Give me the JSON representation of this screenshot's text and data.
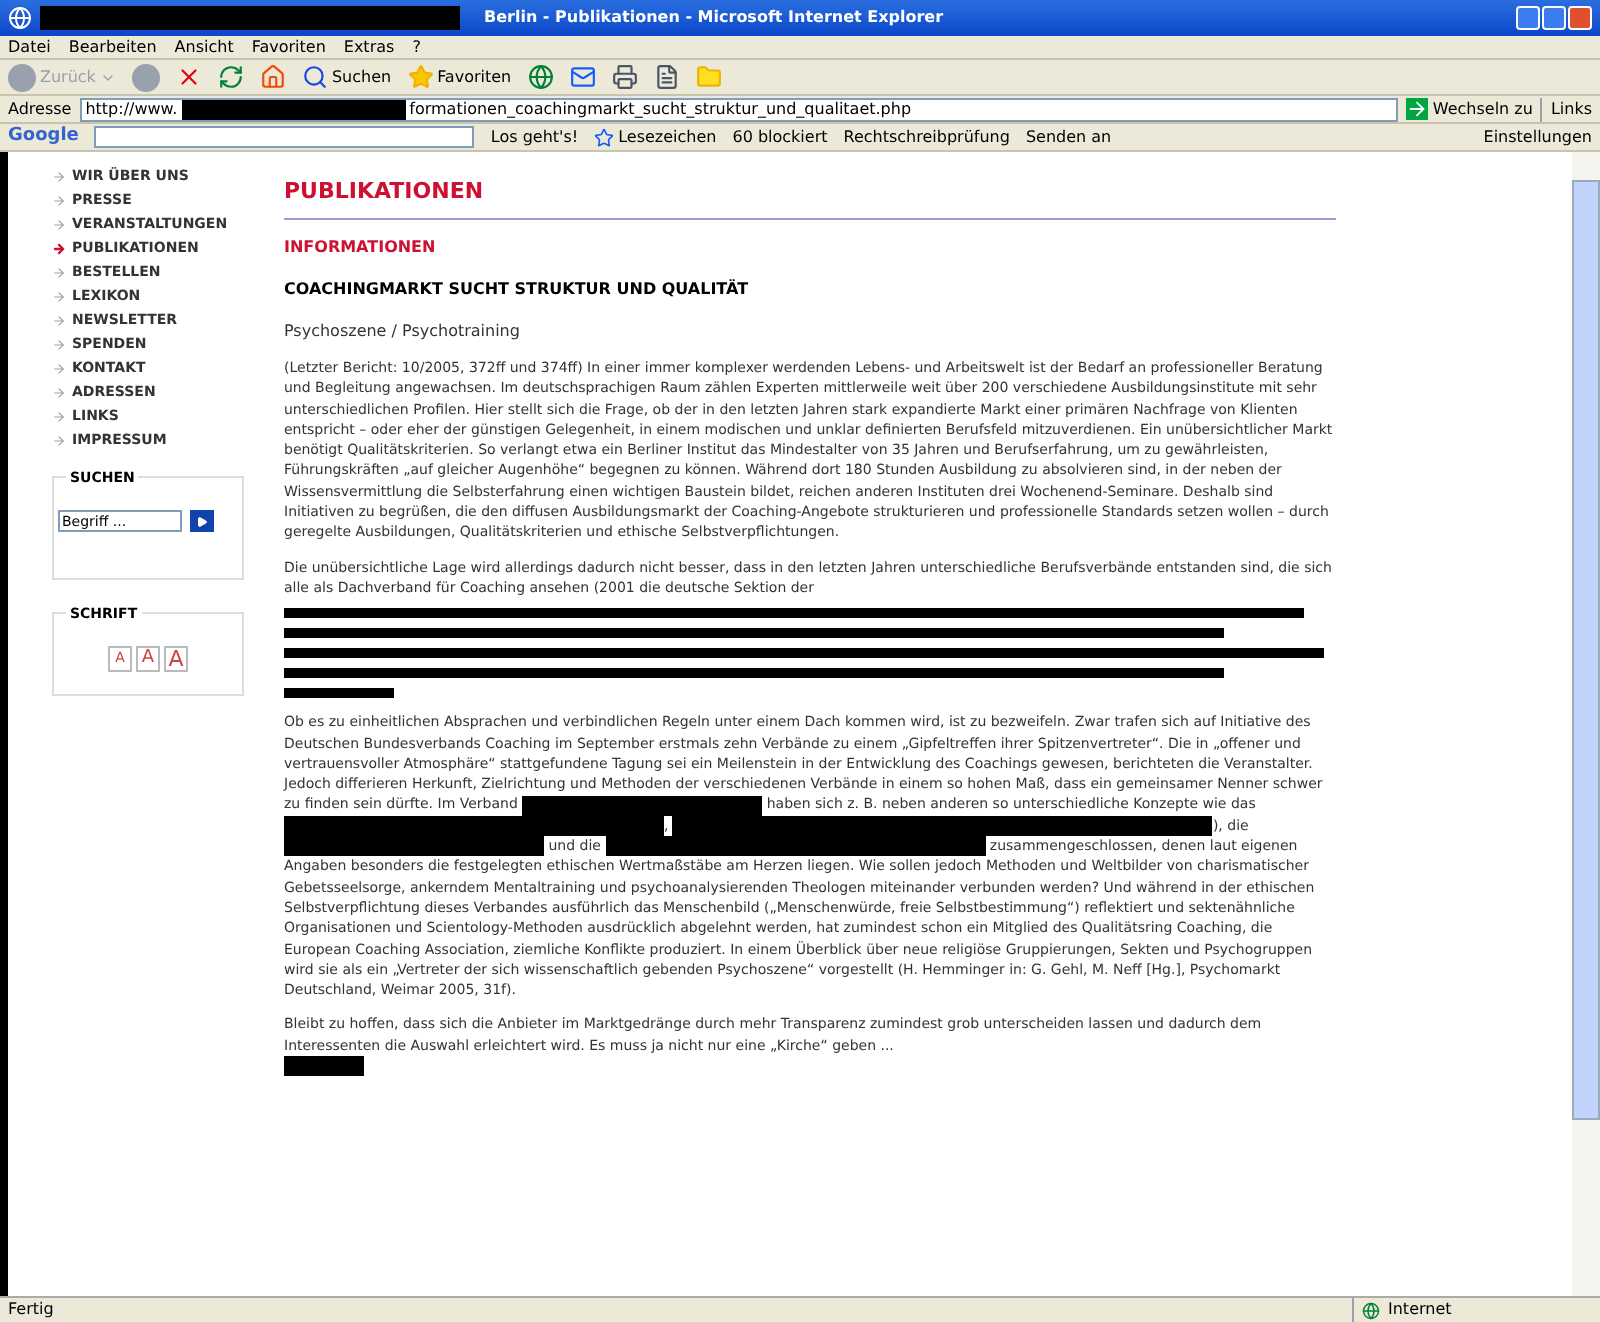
{
  "window": {
    "title": "Berlin - Publikationen - Microsoft Internet Explorer"
  },
  "menu": [
    "Datei",
    "Bearbeiten",
    "Ansicht",
    "Favoriten",
    "Extras",
    "?"
  ],
  "toolbar": {
    "back": "Zurück",
    "search": "Suchen",
    "favorites": "Favoriten"
  },
  "address_bar": {
    "label": "Adresse",
    "url_start": "http://www.",
    "url_end": "formationen_coachingmarkt_sucht_struktur_und_qualitaet.php",
    "go": "Wechseln zu",
    "links": "Links"
  },
  "google_bar": {
    "logo": "Google",
    "go": "Los geht's!",
    "bookmarks": "Lesezeichen",
    "blocked": "60 blockiert",
    "spell": "Rechtschreibprüfung",
    "send": "Senden an",
    "settings": "Einstellungen"
  },
  "sidebar": {
    "items": [
      {
        "label": "WIR ÜBER UNS",
        "selected": false
      },
      {
        "label": "PRESSE",
        "selected": false
      },
      {
        "label": "VERANSTALTUNGEN",
        "selected": false
      },
      {
        "label": "PUBLIKATIONEN",
        "selected": true
      },
      {
        "label": "BESTELLEN",
        "selected": false
      },
      {
        "label": "LEXIKON",
        "selected": false
      },
      {
        "label": "NEWSLETTER",
        "selected": false
      },
      {
        "label": "SPENDEN",
        "selected": false
      },
      {
        "label": "KONTAKT",
        "selected": false
      },
      {
        "label": "ADRESSEN",
        "selected": false
      },
      {
        "label": "LINKS",
        "selected": false
      },
      {
        "label": "IMPRESSUM",
        "selected": false
      }
    ],
    "search": {
      "title": "SUCHEN",
      "placeholder": "Begriff ..."
    },
    "font_size": {
      "title": "SCHRIFT",
      "buttons": [
        "A",
        "A",
        "A"
      ]
    }
  },
  "content": {
    "heading": "PUBLIKATIONEN",
    "section": "INFORMATIONEN",
    "title": "COACHINGMARKT SUCHT STRUKTUR UND QUALITÄT",
    "category": "Psychoszene / Psychotraining",
    "paragraphs": [
      [
        {
          "kind": "text",
          "text": "(Letzter Bericht: 10/2005, 372ff und 374ff) In einer immer komplexer werdenden Lebens- und Arbeitswelt ist der Bedarf an professioneller Beratung und Begleitung angewachsen. Im deutschsprachigen Raum zählen Experten mittlerweile weit über 200 verschiedene Ausbildungsinstitute mit sehr unterschiedlichen Profilen. Hier stellt sich die Frage, ob der in den letzten Jahren stark expandierte Markt einer primären Nachfrage von Klienten entspricht – oder eher der günstigen Gelegenheit, in einem modischen und unklar definierten Berufsfeld mitzuverdienen. Ein unübersichtlicher Markt benötigt Qualitätskriterien. So verlangt etwa ein Berliner Institut das Mindestalter von 35 Jahren und Berufserfahrung, um zu gewährleisten, Führungskräften „auf gleicher Augenhöhe“ begegnen zu können. Während dort 180 Stunden Ausbildung zu absolvieren sind, in der neben der Wissensvermittlung die Selbsterfahrung einen wichtigen Baustein bildet, reichen anderen Instituten drei Wochenend-Seminare. Deshalb sind Initiativen zu begrüßen, die den diffusen Ausbildungsmarkt der Coaching-Angebote strukturieren und professionelle Standards setzen wollen – durch geregelte Ausbildungen, Qualitätskriterien und ethische Selbstverpflichtungen."
        }
      ],
      [
        {
          "kind": "text",
          "text": "Die unübersichtliche Lage wird allerdings dadurch nicht besser, dass in den letzten Jahren unterschiedliche Berufsverbände entstanden sind, die sich alle als Dachverband für Coaching ansehen (2001 die deutsche Sektion der"
        },
        {
          "kind": "struck"
        }
      ],
      [
        {
          "kind": "text",
          "text": "Ob es zu einheitlichen Absprachen und verbindlichen Regeln unter einem Dach kommen wird, ist zu bezweifeln. Zwar trafen sich auf Initiative des Deutschen Bundesverbands Coaching im September erstmals zehn Verbände zu einem „Gipfeltreffen ihrer Spitzenvertreter“. Die in „offener und vertrauensvoller Atmosphäre“ stattgefundene Tagung sei ein Meilenstein in der Entwicklung des Coachings gewesen, berichteten die Veranstalter. Jedoch differieren Herkunft, Zielrichtung und Methoden der verschiedenen Verbände in einem so hohen Maß, dass ein gemeinsamer Nenner schwer zu finden sein dürfte. Im Verband "
        },
        {
          "kind": "redacted"
        },
        {
          "kind": "text",
          "text": " haben sich z. B. neben anderen so unterschiedliche Konzepte wie das "
        },
        {
          "kind": "redacted"
        },
        {
          "kind": "text",
          "text": ", "
        },
        {
          "kind": "redacted"
        },
        {
          "kind": "text",
          "text": "), die "
        },
        {
          "kind": "redacted"
        },
        {
          "kind": "text",
          "text": " und die "
        },
        {
          "kind": "redacted"
        },
        {
          "kind": "text",
          "text": " zusammengeschlossen, denen laut eigenen Angaben besonders die festgelegten ethischen Wertmaßstäbe am Herzen liegen. Wie sollen jedoch Methoden und Weltbilder von charismatischer Gebetsseelsorge, ankerndem Mentaltraining und psychoanalysierenden Theologen miteinander verbunden werden? Und während in der ethischen Selbstverpflichtung dieses Verbandes ausführlich das Menschenbild („Menschenwürde, freie Selbstbestimmung“) reflektiert und sektenähnliche Organisationen und Scientology-Methoden ausdrücklich abgelehnt werden, hat zumindest schon ein Mitglied des Qualitätsring Coaching, die European Coaching Association, ziemliche Konflikte produziert. In einem Überblick über neue religiöse Gruppierungen, Sekten und Psychogruppen wird sie als ein „Vertreter der sich wissenschaftlich gebenden Psychoszene“ vorgestellt (H. Hemminger in: G. Gehl, M. Neff [Hg.], Psychomarkt Deutschland, Weimar 2005, 31f)."
        }
      ],
      [
        {
          "kind": "text",
          "text": "Bleibt zu hoffen, dass sich die Anbieter im Marktgedränge durch mehr Transparenz zumindest grob unterscheiden lassen und dadurch dem Interessenten die Auswahl erleichtert wird. Es muss ja nicht nur eine „Kirche“ geben ..."
        }
      ]
    ]
  },
  "status_bar": {
    "text": "Fertig",
    "zone": "Internet"
  }
}
